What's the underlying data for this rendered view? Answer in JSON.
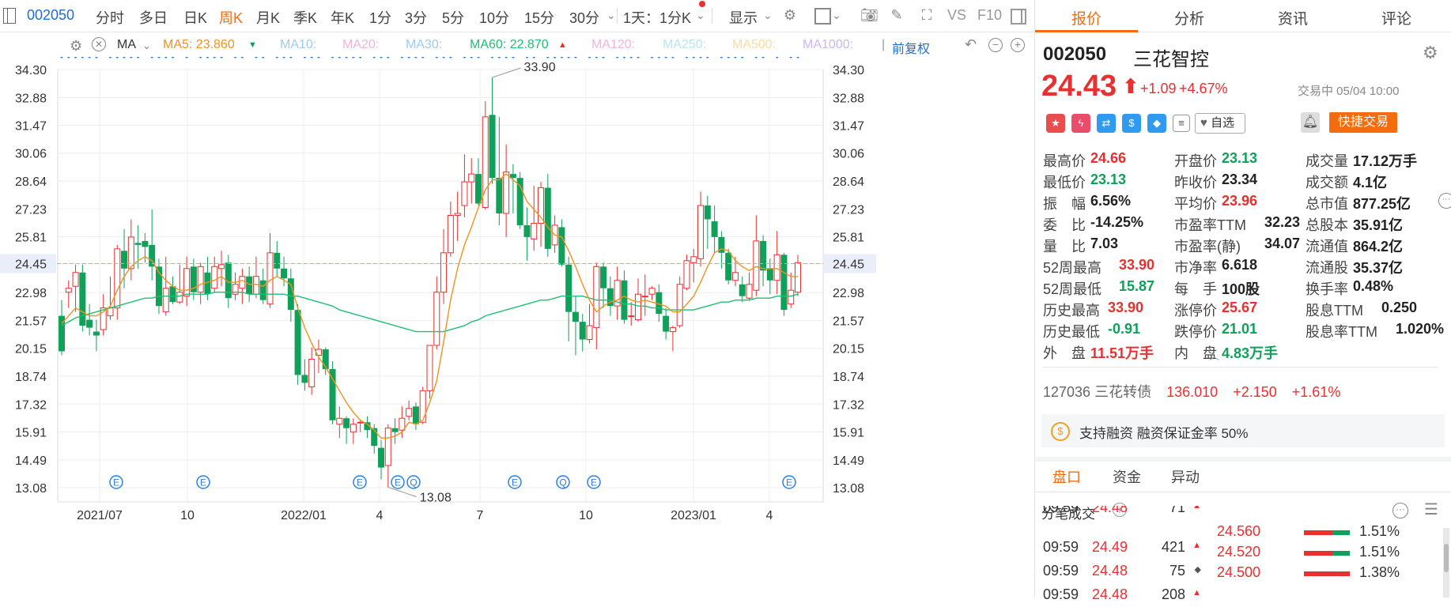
{
  "toolbar": {
    "code": "002050",
    "periods": [
      "分时",
      "多日",
      "日K",
      "周K",
      "月K",
      "季K",
      "年K",
      "1分",
      "3分",
      "5分",
      "10分",
      "15分",
      "30分"
    ],
    "active_period": "周K",
    "interval": "1天：1分K",
    "display": "显示",
    "vs": "VS",
    "f10": "F10"
  },
  "ma_row": {
    "ma_label": "MA",
    "ma5": "MA5: 23.860",
    "ma10": "MA10:",
    "ma20": "MA20:",
    "ma30": "MA30:",
    "ma60": "MA60: 22.870",
    "ma120": "MA120:",
    "ma250": "MA250:",
    "ma500": "MA500:",
    "ma1000": "MA1000:",
    "fuquan": "前复权"
  },
  "colors": {
    "up": "#e93030",
    "down": "#0fa05a",
    "ma5": "#f0921e",
    "ma60": "#1fbf74",
    "accent": "#f56c0f",
    "link": "#1e6fd9"
  },
  "chart_data": {
    "type": "candlestick",
    "y_ticks": [
      "34.30",
      "32.88",
      "31.47",
      "30.06",
      "28.64",
      "27.23",
      "25.81",
      "24.45",
      "22.98",
      "21.57",
      "20.15",
      "18.74",
      "17.32",
      "15.91",
      "14.49",
      "13.08"
    ],
    "ylim": [
      13.08,
      34.3
    ],
    "x_ticks": [
      "2021/07",
      "10",
      "2022/01",
      "4",
      "7",
      "10",
      "2023/01",
      "4"
    ],
    "current_price_line": 24.45,
    "high_label": "33.90",
    "low_label": "13.08",
    "event_markers": [
      "E",
      "E",
      "E",
      "E",
      "Q",
      "E",
      "Q",
      "E",
      "E"
    ],
    "candles": [
      [
        21.8,
        20.0,
        22.6,
        19.8
      ],
      [
        23.0,
        23.2,
        23.6,
        22.2
      ],
      [
        23.3,
        24.0,
        24.4,
        22.0
      ],
      [
        24.0,
        21.3,
        24.4,
        21.0
      ],
      [
        21.6,
        21.2,
        22.4,
        20.8
      ],
      [
        21.0,
        20.8,
        21.6,
        20.0
      ],
      [
        21.1,
        22.2,
        22.9,
        20.8
      ],
      [
        21.8,
        22.2,
        23.8,
        21.6
      ],
      [
        22.2,
        25.2,
        25.4,
        21.6
      ],
      [
        25.1,
        24.2,
        26.2,
        23.2
      ],
      [
        24.2,
        25.8,
        26.7,
        23.6
      ],
      [
        25.5,
        25.4,
        26.4,
        24.2
      ],
      [
        25.6,
        25.3,
        26.0,
        24.5
      ],
      [
        25.4,
        24.3,
        27.2,
        23.6
      ],
      [
        24.3,
        22.3,
        24.7,
        21.9
      ],
      [
        22.0,
        23.2,
        24.8,
        21.8
      ],
      [
        23.3,
        22.5,
        23.8,
        22.4
      ],
      [
        22.5,
        23.0,
        24.4,
        22.4
      ],
      [
        22.8,
        24.2,
        24.8,
        22.3
      ],
      [
        24.3,
        23.0,
        24.7,
        22.6
      ],
      [
        23.0,
        24.3,
        24.5,
        22.4
      ],
      [
        24.0,
        22.9,
        24.8,
        22.6
      ],
      [
        23.2,
        24.3,
        24.8,
        23.0
      ],
      [
        24.2,
        24.4,
        25.1,
        23.3
      ],
      [
        24.5,
        22.7,
        24.9,
        22.2
      ],
      [
        22.9,
        23.4,
        24.0,
        22.6
      ],
      [
        23.2,
        23.8,
        24.2,
        22.4
      ],
      [
        23.8,
        22.9,
        24.3,
        22.5
      ],
      [
        22.9,
        23.8,
        24.8,
        22.7
      ],
      [
        23.6,
        22.6,
        24.2,
        22.4
      ],
      [
        22.4,
        25.0,
        26.0,
        22.2
      ],
      [
        25.0,
        24.2,
        25.6,
        23.8
      ],
      [
        24.2,
        23.7,
        24.8,
        23.3
      ],
      [
        23.7,
        22.1,
        24.2,
        21.5
      ],
      [
        22.1,
        18.8,
        22.4,
        18.3
      ],
      [
        18.8,
        18.4,
        19.6,
        18.0
      ],
      [
        18.2,
        19.6,
        20.2,
        17.8
      ],
      [
        19.8,
        20.1,
        20.6,
        18.9
      ],
      [
        20.1,
        19.1,
        20.2,
        18.8
      ],
      [
        19.1,
        16.5,
        19.5,
        16.3
      ],
      [
        16.3,
        16.6,
        17.2,
        15.6
      ],
      [
        16.6,
        16.1,
        16.7,
        15.3
      ],
      [
        15.9,
        16.3,
        16.6,
        15.3
      ],
      [
        16.4,
        16.4,
        16.5,
        15.9
      ],
      [
        16.4,
        16.0,
        16.7,
        15.6
      ],
      [
        16.1,
        15.2,
        16.3,
        14.8
      ],
      [
        15.1,
        14.1,
        15.5,
        13.5
      ],
      [
        14.2,
        16.1,
        16.3,
        13.1
      ],
      [
        16.1,
        15.9,
        16.6,
        15.3
      ],
      [
        16.0,
        16.6,
        17.2,
        15.6
      ],
      [
        16.7,
        17.1,
        17.5,
        16.5
      ],
      [
        17.2,
        16.3,
        17.4,
        16.0
      ],
      [
        16.4,
        18.0,
        18.2,
        16.3
      ],
      [
        18.0,
        20.3,
        20.3,
        17.6
      ],
      [
        20.3,
        23.0,
        23.8,
        20.1
      ],
      [
        23.0,
        25.0,
        26.2,
        22.4
      ],
      [
        25.0,
        26.9,
        27.6,
        24.8
      ],
      [
        26.9,
        27.0,
        28.1,
        25.6
      ],
      [
        27.4,
        28.6,
        30.0,
        26.8
      ],
      [
        28.6,
        29.0,
        29.8,
        27.5
      ],
      [
        29.0,
        27.5,
        29.8,
        27.4
      ],
      [
        27.3,
        31.9,
        32.7,
        27.2
      ],
      [
        32.0,
        28.8,
        33.9,
        28.5
      ],
      [
        28.8,
        27.0,
        31.9,
        26.4
      ],
      [
        27.0,
        29.1,
        30.5,
        25.8
      ],
      [
        29.0,
        28.8,
        29.5,
        27.0
      ],
      [
        28.8,
        26.4,
        29.1,
        26.2
      ],
      [
        26.4,
        25.8,
        27.3,
        24.6
      ],
      [
        25.7,
        26.5,
        28.4,
        25.1
      ],
      [
        26.5,
        28.3,
        28.6,
        25.3
      ],
      [
        28.3,
        25.2,
        29.0,
        24.8
      ],
      [
        25.4,
        26.4,
        26.9,
        25.0
      ],
      [
        26.3,
        24.4,
        26.7,
        24.3
      ],
      [
        24.4,
        22.0,
        24.8,
        20.5
      ],
      [
        22.0,
        21.5,
        22.8,
        19.8
      ],
      [
        21.5,
        20.6,
        21.9,
        20.0
      ],
      [
        20.6,
        21.3,
        22.4,
        20.4
      ],
      [
        21.2,
        24.3,
        24.5,
        20.1
      ],
      [
        24.3,
        23.2,
        24.5,
        22.2
      ],
      [
        23.2,
        22.3,
        23.8,
        21.8
      ],
      [
        22.3,
        23.6,
        24.3,
        21.6
      ],
      [
        23.6,
        21.6,
        24.1,
        21.4
      ],
      [
        21.8,
        21.8,
        22.5,
        21.3
      ],
      [
        21.6,
        22.9,
        23.7,
        21.5
      ],
      [
        22.8,
        22.8,
        23.9,
        21.8
      ],
      [
        22.9,
        23.2,
        23.3,
        22.6
      ],
      [
        23.0,
        21.9,
        23.4,
        21.5
      ],
      [
        21.8,
        21.0,
        22.2,
        20.6
      ],
      [
        21.0,
        21.2,
        21.3,
        20.0
      ],
      [
        21.3,
        23.4,
        23.8,
        21.2
      ],
      [
        23.2,
        24.6,
        24.9,
        23.1
      ],
      [
        24.5,
        24.8,
        25.2,
        23.5
      ],
      [
        24.7,
        27.4,
        28.1,
        24.3
      ],
      [
        27.4,
        26.7,
        27.9,
        25.2
      ],
      [
        26.6,
        25.8,
        27.4,
        25.0
      ],
      [
        25.8,
        25.0,
        26.1,
        24.2
      ],
      [
        25.0,
        23.6,
        25.2,
        23.4
      ],
      [
        23.6,
        24.0,
        24.8,
        23.3
      ],
      [
        23.4,
        22.8,
        23.8,
        22.5
      ],
      [
        22.7,
        23.4,
        24.0,
        22.6
      ],
      [
        23.1,
        25.6,
        26.9,
        22.8
      ],
      [
        25.6,
        24.1,
        25.9,
        23.3
      ],
      [
        24.2,
        23.6,
        24.7,
        22.9
      ],
      [
        23.6,
        24.9,
        26.1,
        22.9
      ],
      [
        24.9,
        22.1,
        25.0,
        21.8
      ],
      [
        22.4,
        23.1,
        24.0,
        22.2
      ],
      [
        23.0,
        24.5,
        24.9,
        22.8
      ]
    ],
    "ma5": [
      21.4,
      21.8,
      22.2,
      22.0,
      21.8,
      21.8,
      22.0,
      22.3,
      23.1,
      23.8,
      24.3,
      24.6,
      24.8,
      24.6,
      24.0,
      23.6,
      23.3,
      23.1,
      23.1,
      23.2,
      23.4,
      23.5,
      23.6,
      23.8,
      23.5,
      23.5,
      23.6,
      23.4,
      23.4,
      23.3,
      23.6,
      23.8,
      23.6,
      23.4,
      22.2,
      21.2,
      20.4,
      19.7,
      19.2,
      18.6,
      18.0,
      17.4,
      16.9,
      16.5,
      16.3,
      16.0,
      15.6,
      15.6,
      15.7,
      15.9,
      16.4,
      16.3,
      16.5,
      17.4,
      18.5,
      20.5,
      22.6,
      24.2,
      25.4,
      26.3,
      27.3,
      28.2,
      28.7,
      28.7,
      29.0,
      28.7,
      28.4,
      27.6,
      27.2,
      26.8,
      26.3,
      25.9,
      25.8,
      25.1,
      24.3,
      23.4,
      22.6,
      22.0,
      22.3,
      22.5,
      22.6,
      22.8,
      22.6,
      22.5,
      22.6,
      22.5,
      22.4,
      22.3,
      22.0,
      22.0,
      22.4,
      22.8,
      23.5,
      24.3,
      25.0,
      25.2,
      25.1,
      24.6,
      24.3,
      24.1,
      24.3,
      24.2,
      24.2,
      24.2,
      24.0,
      23.8,
      23.8
    ],
    "ma60": [
      21.3,
      21.5,
      21.7,
      21.8,
      21.9,
      22.0,
      22.1,
      22.2,
      22.3,
      22.4,
      22.5,
      22.6,
      22.7,
      22.7,
      22.8,
      22.8,
      22.8,
      22.8,
      22.9,
      22.9,
      22.9,
      22.9,
      23.0,
      23.0,
      23.0,
      23.0,
      23.0,
      22.9,
      22.9,
      22.9,
      22.9,
      22.9,
      22.9,
      22.8,
      22.8,
      22.7,
      22.6,
      22.5,
      22.4,
      22.3,
      22.1,
      22.0,
      21.9,
      21.8,
      21.7,
      21.6,
      21.5,
      21.4,
      21.3,
      21.2,
      21.1,
      21.0,
      21.0,
      21.0,
      21.0,
      21.0,
      21.1,
      21.2,
      21.3,
      21.5,
      21.6,
      21.8,
      21.9,
      22.0,
      22.1,
      22.2,
      22.3,
      22.4,
      22.5,
      22.6,
      22.6,
      22.7,
      22.8,
      22.8,
      22.8,
      22.8,
      22.7,
      22.6,
      22.6,
      22.6,
      22.5,
      22.4,
      22.4,
      22.3,
      22.3,
      22.2,
      22.2,
      22.1,
      22.1,
      22.1,
      22.1,
      22.1,
      22.2,
      22.3,
      22.4,
      22.5,
      22.5,
      22.6,
      22.6,
      22.6,
      22.7,
      22.7,
      22.7,
      22.8,
      22.8,
      22.8,
      22.9
    ]
  },
  "right": {
    "tabs": [
      "报价",
      "分析",
      "资讯",
      "评论"
    ],
    "code": "002050",
    "name": "三花智控",
    "price": "24.43",
    "change": "+1.09",
    "change_pct": "+4.67%",
    "status": "交易中 05/04 10:00",
    "watch": "自选",
    "quick_trade": "快捷交易",
    "quotes": [
      [
        {
          "k": "最高价",
          "v": "24.66",
          "c": "red"
        },
        {
          "k": "开盘价",
          "v": "23.13",
          "c": "green"
        },
        {
          "k": "成交量",
          "v": "17.12万手",
          "c": "dark"
        }
      ],
      [
        {
          "k": "最低价",
          "v": "23.13",
          "c": "green"
        },
        {
          "k": "昨收价",
          "v": "23.34",
          "c": "dark"
        },
        {
          "k": "成交额",
          "v": "4.1亿",
          "c": "dark"
        }
      ],
      [
        {
          "k": "振　幅",
          "v": "6.56%",
          "c": "dark"
        },
        {
          "k": "平均价",
          "v": "23.96",
          "c": "red"
        },
        {
          "k": "总市值",
          "v": "877.25亿",
          "c": "dark"
        }
      ],
      [
        {
          "k": "委　比",
          "v": "-14.25%",
          "c": "dark"
        },
        {
          "k": "市盈率TTM",
          "v": "32.23",
          "c": "dark"
        },
        {
          "k": "总股本",
          "v": "35.91亿",
          "c": "dark"
        }
      ],
      [
        {
          "k": "量　比",
          "v": "7.03",
          "c": "dark"
        },
        {
          "k": "市盈率(静)",
          "v": "34.07",
          "c": "dark"
        },
        {
          "k": "流通值",
          "v": "864.2亿",
          "c": "dark"
        }
      ],
      [
        {
          "k": "52周最高",
          "v": "33.90",
          "c": "red"
        },
        {
          "k": "市净率",
          "v": "6.618",
          "c": "dark"
        },
        {
          "k": "流通股",
          "v": "35.37亿",
          "c": "dark"
        }
      ],
      [
        {
          "k": "52周最低",
          "v": "15.87",
          "c": "green"
        },
        {
          "k": "每　手",
          "v": "100股",
          "c": "dark"
        },
        {
          "k": "换手率",
          "v": "0.48%",
          "c": "dark"
        }
      ],
      [
        {
          "k": "历史最高",
          "v": "33.90",
          "c": "red"
        },
        {
          "k": "涨停价",
          "v": "25.67",
          "c": "red"
        },
        {
          "k": "股息TTM",
          "v": "0.250",
          "c": "dark"
        }
      ],
      [
        {
          "k": "历史最低",
          "v": "-0.91",
          "c": "green"
        },
        {
          "k": "跌停价",
          "v": "21.01",
          "c": "green"
        },
        {
          "k": "股息率TTM",
          "v": "1.020%",
          "c": "dark"
        }
      ],
      [
        {
          "k": "外　盘",
          "v": "11.51万手",
          "c": "red"
        },
        {
          "k": "内　盘",
          "v": "4.83万手",
          "c": "green"
        }
      ]
    ],
    "bond": {
      "code": "127036",
      "name": "三花转债",
      "price": "136.010",
      "change": "+2.150",
      "pct": "+1.61%"
    },
    "margin": "支持融资 融资保证金率 50%",
    "subtabs": [
      "盘口",
      "资金",
      "异动"
    ],
    "ticks_title": "分笔成交",
    "ticks": [
      {
        "time": "09:59",
        "price": "24.48",
        "vol": "71",
        "dir": "up"
      },
      {
        "time": "09:59",
        "price": "24.49",
        "vol": "421",
        "dir": "up"
      },
      {
        "time": "09:59",
        "price": "24.48",
        "vol": "75",
        "dir": "flat"
      },
      {
        "time": "09:59",
        "price": "24.48",
        "vol": "208",
        "dir": "up"
      }
    ],
    "levels": [
      {
        "price": "24.560",
        "pct": "1.51%"
      },
      {
        "price": "24.520",
        "pct": "1.51%"
      },
      {
        "price": "24.500",
        "pct": "1.38%"
      }
    ]
  }
}
